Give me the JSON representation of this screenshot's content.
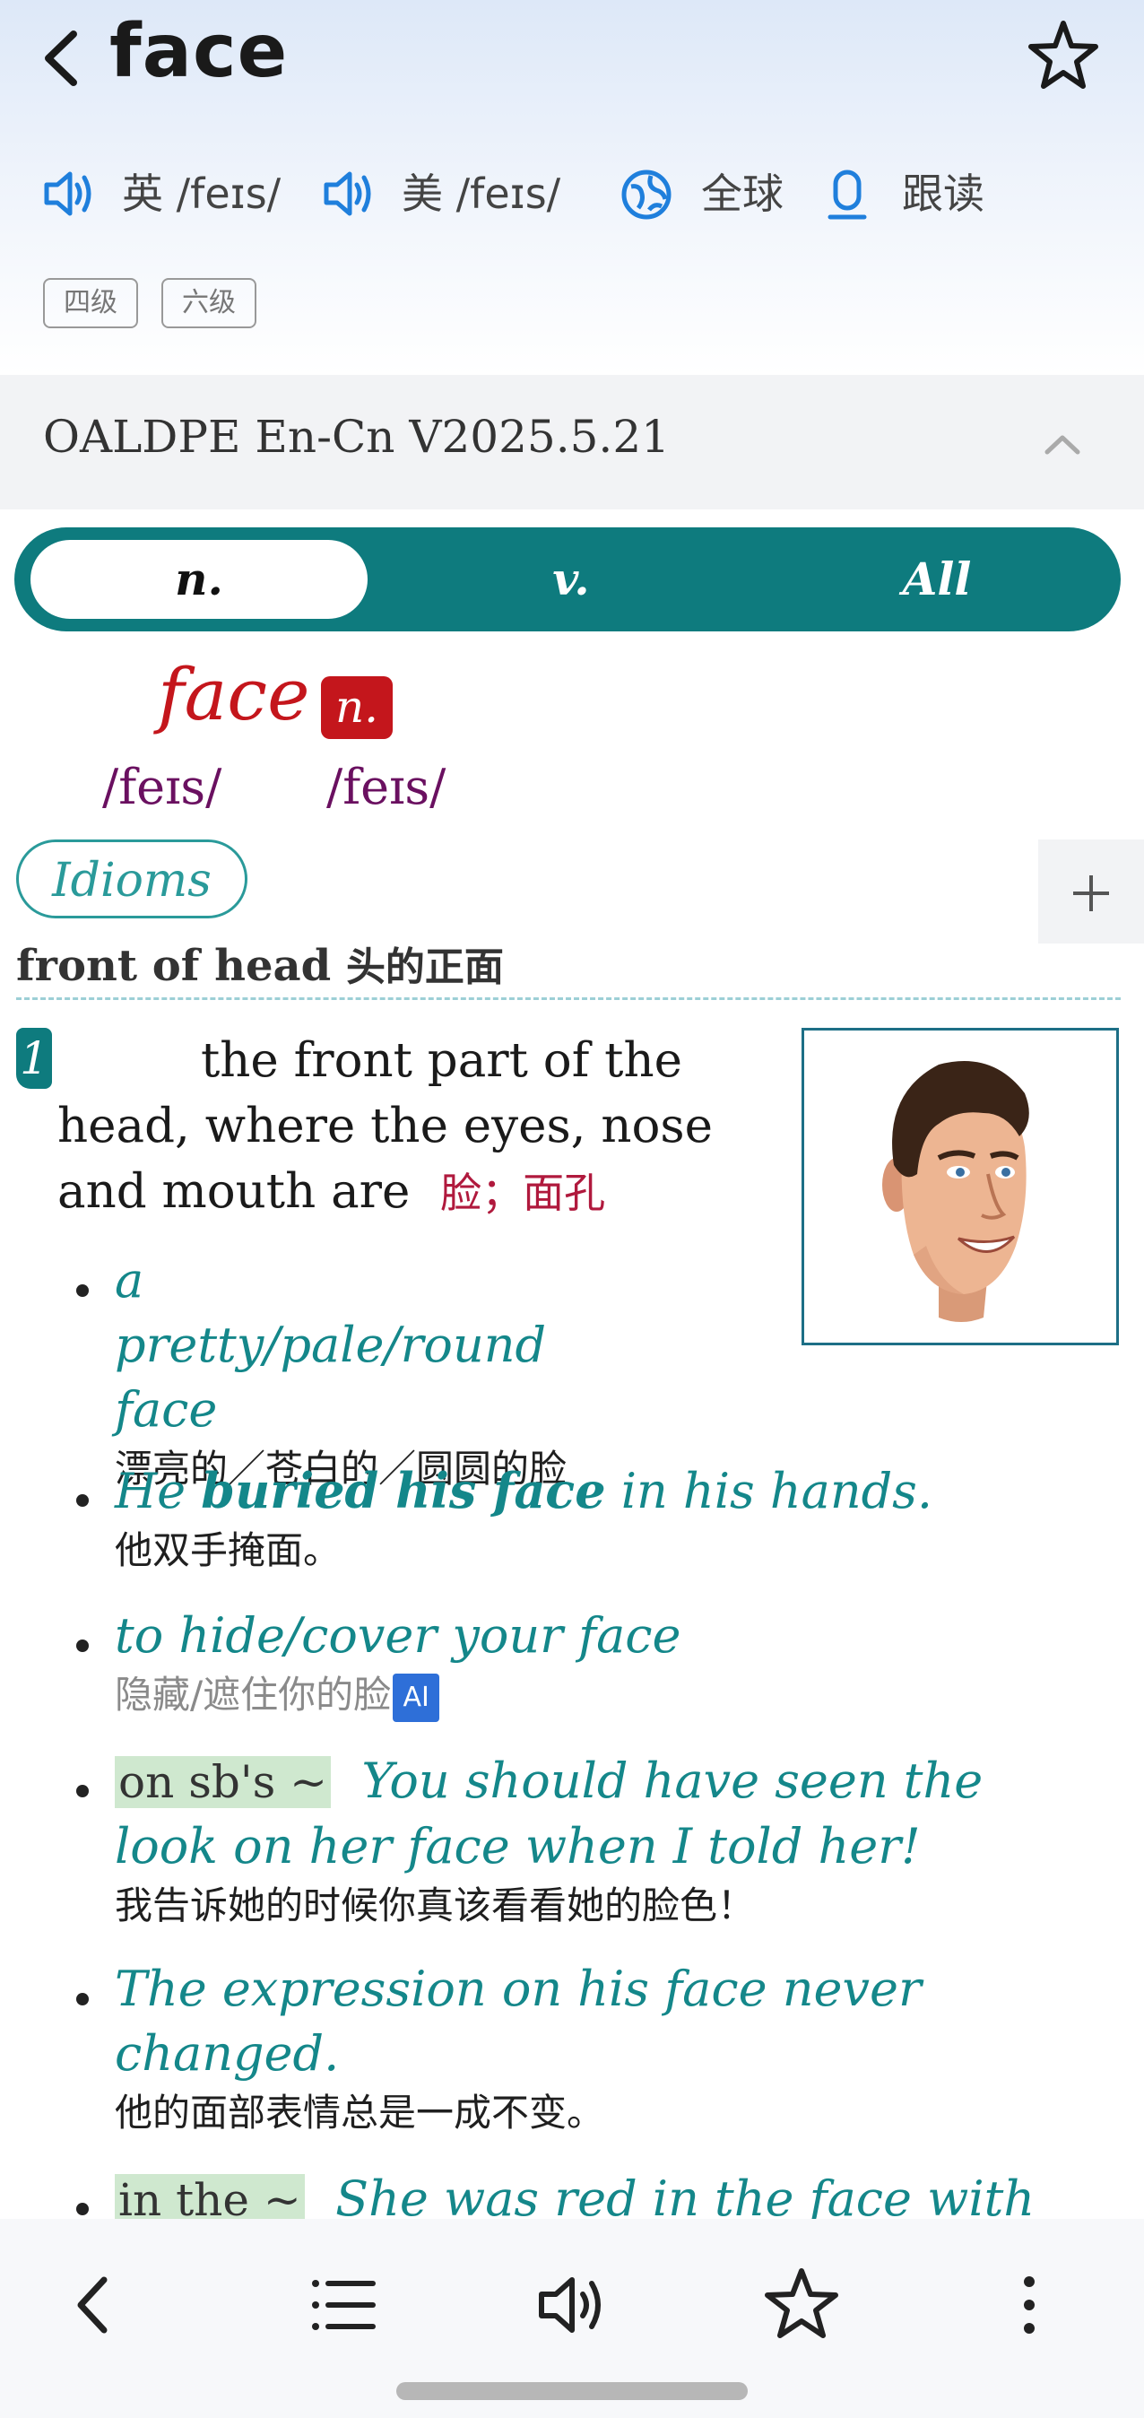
{
  "header": {
    "title": "face",
    "pron_uk_label": "英",
    "pron_uk": "/feɪs/",
    "pron_us_label": "美",
    "pron_us": "/feɪs/",
    "global_label": "全球",
    "follow_read_label": "跟读",
    "tags": [
      "四级",
      "六级"
    ]
  },
  "dictionary": {
    "name": "OALDPE En-Cn V2025.5.21"
  },
  "pos_tabs": [
    {
      "label": "n.",
      "active": true
    },
    {
      "label": "v.",
      "active": false
    },
    {
      "label": "All",
      "active": false
    }
  ],
  "entry": {
    "headword": "face",
    "pos": "n.",
    "ipa_1": "/feɪs/",
    "ipa_2": "/feɪs/",
    "idioms_label": "Idioms",
    "expand_symbol": "+",
    "sense_heading_en": "front of head",
    "sense_heading_cn": "头的正面",
    "sense": {
      "number": "1",
      "definition_en": "the front part of the head, where the eyes, nose and mouth are",
      "definition_cn": "脸；面孔",
      "examples": [
        {
          "en": "a pretty/pale/round face",
          "cn": "漂亮的／苍白的／圆圆的脸"
        },
        {
          "en_pre": "He ",
          "en_bold": "buried his face",
          "en_post": " in his hands.",
          "cn": "他双手掩面。"
        },
        {
          "en": "to hide/cover your face",
          "cn": "隐藏/遮住你的脸",
          "ai_label": "AI"
        },
        {
          "pattern": "on sb's ~",
          "en": "You should have seen the look on her face when I told her!",
          "cn": "我告诉她的时候你真该看看她的脸色！"
        },
        {
          "en": "The expression on his face never changed.",
          "cn": "他的面部表情总是一成不变。"
        },
        {
          "pattern": "in the ~",
          "en": "She was red in the face with"
        }
      ]
    }
  },
  "colors": {
    "accent_teal": "#0e7b7e",
    "headword_red": "#c4161c",
    "example_teal": "#14878a",
    "icon_blue": "#1f7fdc"
  }
}
